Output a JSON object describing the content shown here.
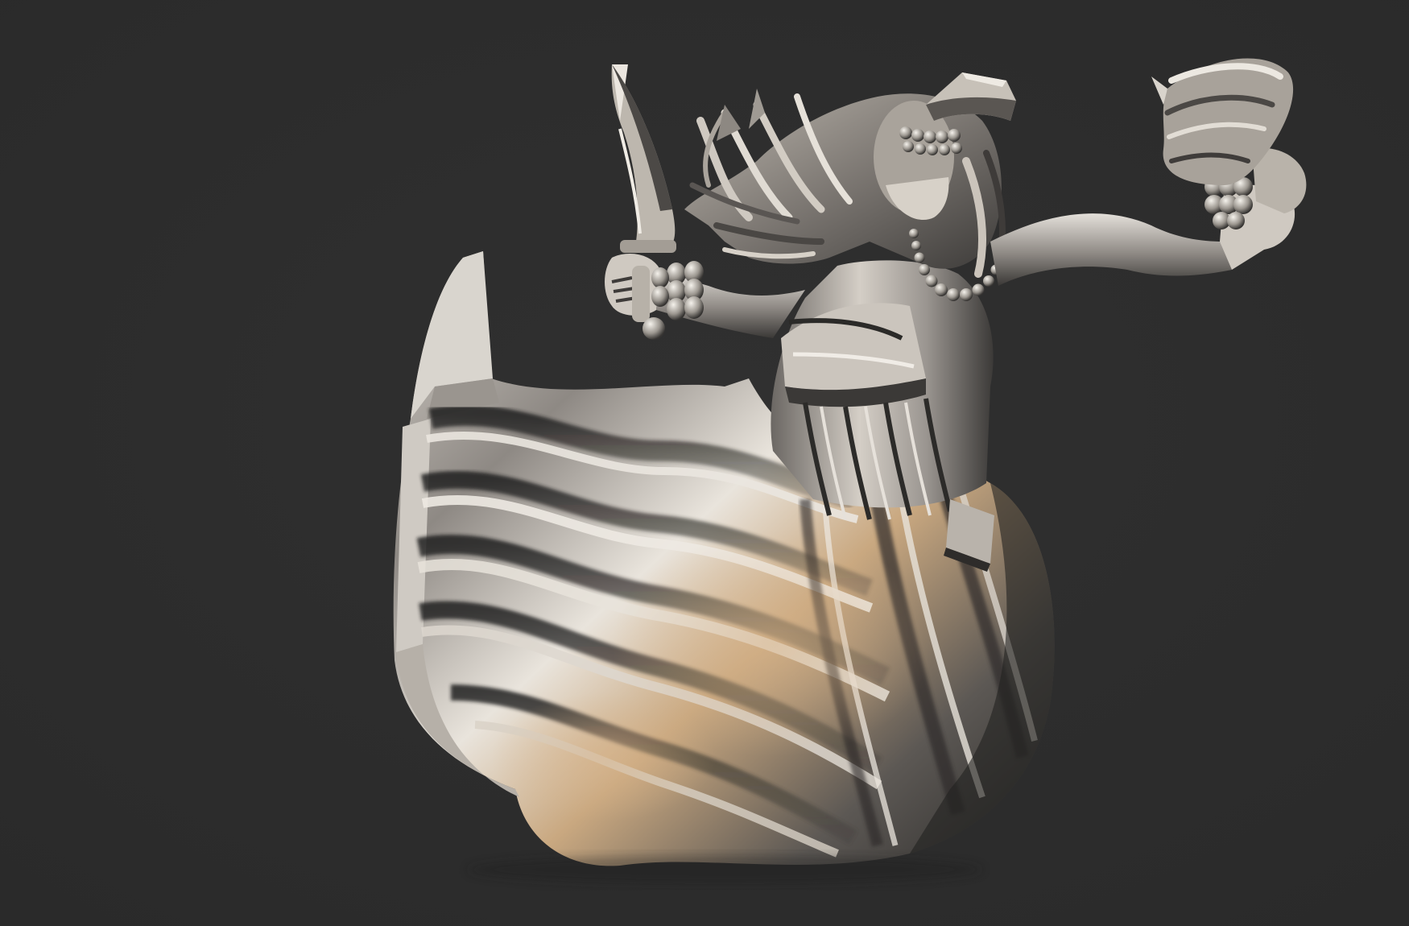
{
  "viewport": {
    "background_color": "#303030",
    "background_edge_color": "#2a2a2a"
  },
  "sculpture": {
    "subject": "dancing-woman-relief",
    "material_colors": {
      "highlight": "#f2efe8",
      "light": "#cfc8bd",
      "mid": "#8f8a84",
      "dark": "#4a4745",
      "deep": "#222120",
      "warm": "#c9a880",
      "cool": "#8fa0b4"
    },
    "icons": [
      "curved-dagger-icon",
      "scarf-icon",
      "bead-necklace-icon",
      "bangle-icon",
      "blindfold-icon"
    ]
  }
}
